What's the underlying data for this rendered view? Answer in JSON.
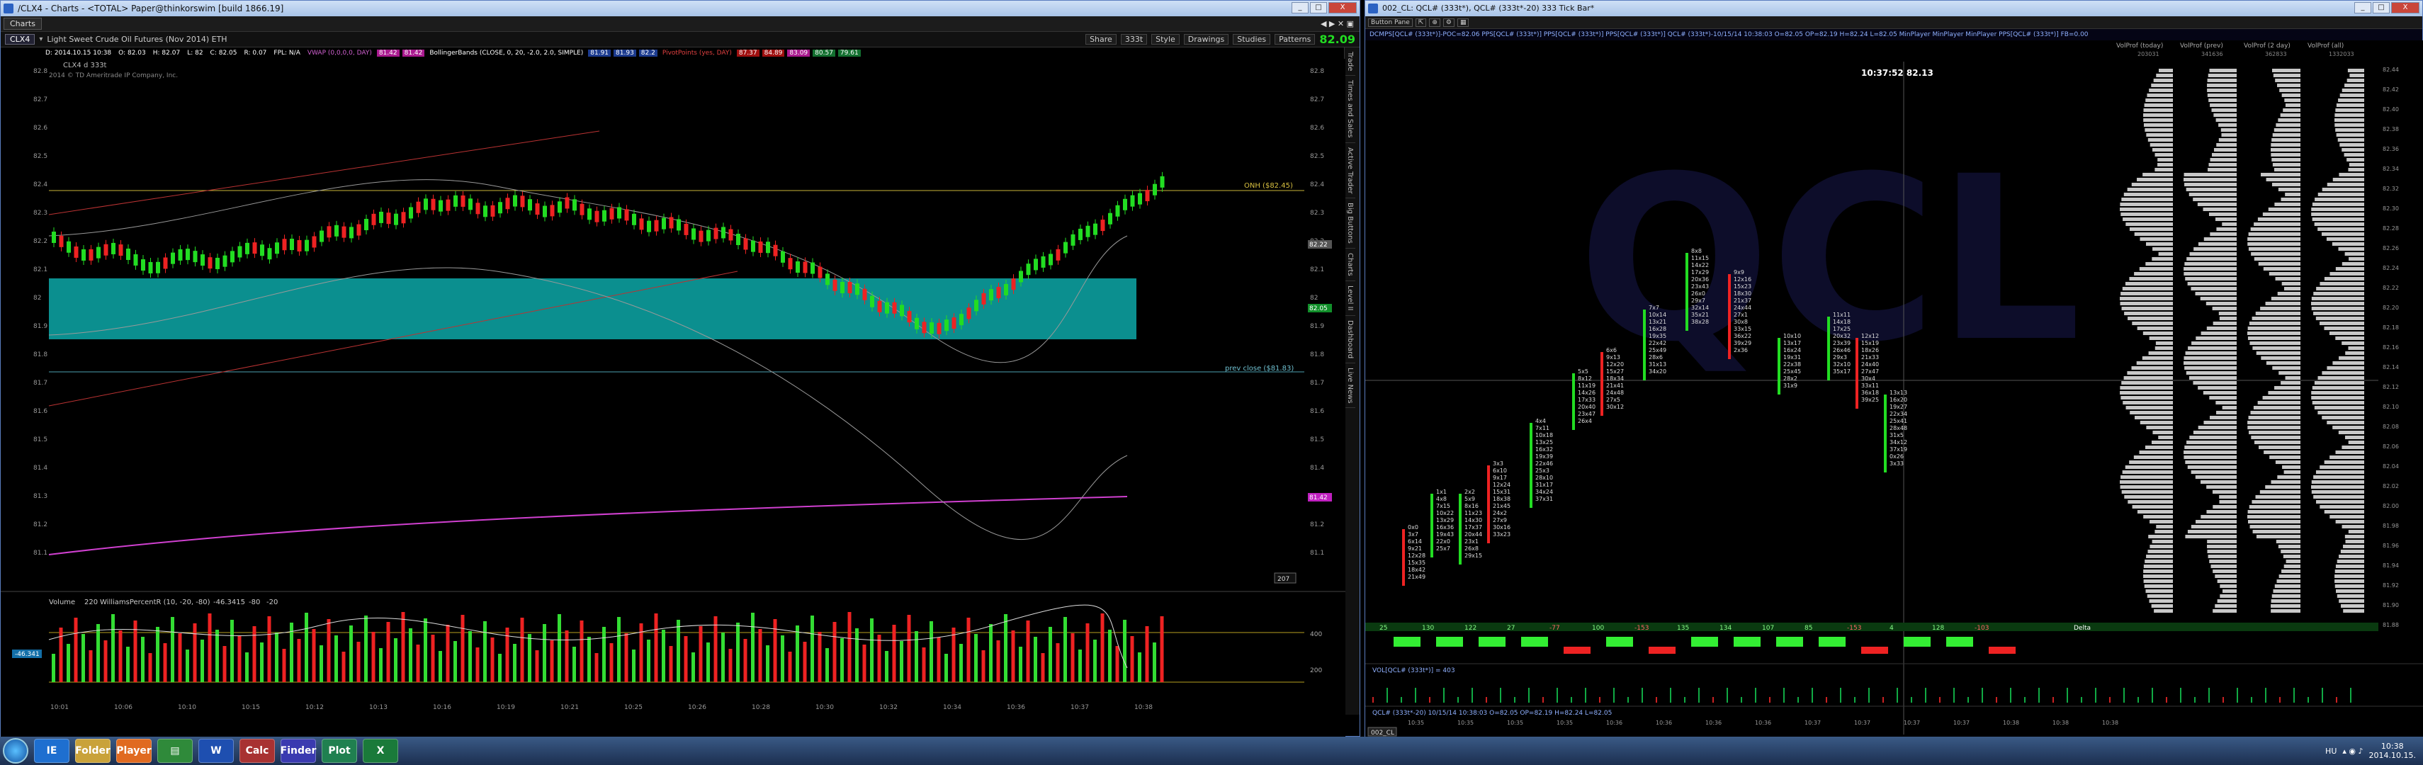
{
  "left": {
    "title": "/CLX4 - Charts - <TOTAL> Paper@thinkorswim [build 1866.19]",
    "tab": "Charts",
    "symbol": "CLX4",
    "description": "Light Sweet Crude Oil Futures (Nov 2014) ETH",
    "toolbar_buttons": [
      "Share",
      "Style",
      "Drawings",
      "Studies",
      "Patterns"
    ],
    "toolbar_sel": "333t",
    "last_price": "82.09",
    "status": {
      "d": "D: 2014.10.15 10:38",
      "o": "O: 82.03",
      "h": "H: 82.07",
      "l": "L: 82",
      "c": "C: 82.05",
      "r": "R: 0.07",
      "fpl": "FPL: N/A",
      "vwap": "VWAP (0,0,0,0, DAY)",
      "vwap1": "81.42",
      "vwap2": "81.42",
      "boll": "BollingerBands (CLOSE, 0, 20, -2.0, 2.0, SIMPLE)",
      "b1": "81.91",
      "b2": "81.93",
      "b3": "82.2",
      "pivots": "PivotPoints (yes, DAY)",
      "p1": "87.37",
      "p2": "84.89",
      "p3": "83.09",
      "p4": "80.57",
      "p5": "79.61"
    },
    "symbol_tag": "CLX4 d 333t",
    "copyright": "2014 © TD Ameritrade IP Company, Inc.",
    "onh_label": "ONH ($82.45)",
    "prevclose_label": "prev close ($81.83)",
    "price_ticks": [
      "82.8",
      "82.7",
      "82.6",
      "82.5",
      "82.4",
      "82.3",
      "82.2",
      "82.1",
      "82",
      "81.9",
      "81.8",
      "81.7",
      "81.6",
      "81.5",
      "81.4",
      "81.3",
      "81.2",
      "81.1"
    ],
    "right_tags": {
      "t1": "82.22",
      "t2": "82.05",
      "t3": "81.42",
      "t4": "207"
    },
    "time_ticks": [
      "10:01",
      "10:06",
      "10:10",
      "10:15",
      "10:12",
      "10:13",
      "10:16",
      "10:19",
      "10:21",
      "10:25",
      "10:26",
      "10:28",
      "10:30",
      "10:32",
      "10:34",
      "10:36",
      "10:37",
      "10:38"
    ],
    "volume_label": "Volume",
    "volume_val": "220",
    "wr_label": "WilliamsPercentR (10, -20, -80)",
    "wr_val": "-46.3415",
    "wr_v2": "-80",
    "wr_v3": "-20",
    "wr_tag": "-46.341",
    "lower_ticks": [
      "400",
      "200"
    ],
    "side_tabs": [
      "Trade",
      "Times and Sales",
      "Active Trader",
      "Big Buttons",
      "Charts",
      "Level II",
      "Dashboard",
      "Live News"
    ]
  },
  "right": {
    "title": "002_CL: QCL# (333t*), QCL# (333t*-20) 333 Tick Bar*",
    "button_pane": "Button Pane",
    "header": "DCMPS[QCL# (333t*)]-POC=82.06  PPS[QCL# (333t*)]  PPS[QCL# (333t*)]  PPS[QCL# (333t*)]  QCL# (333t*)-10/15/14 10:38:03 O=82.05 OP=82.19 H=82.24 L=82.05  MinPlayer  MinPlayer  MinPlayer  PPS[QCL# (333t*)] FB=0.00",
    "crosshair_label": "10:37:52  82.13",
    "crosshair_price": "82.13",
    "vp_headers": [
      "VolProf (today)",
      "VolProf (prev)",
      "VolProf (2 day)",
      "VolProf (all)"
    ],
    "vp_sub": [
      "203031",
      "341636",
      "362833",
      "1332033"
    ],
    "price_ticks": [
      "82.44",
      "82.42",
      "82.40",
      "82.38",
      "82.36",
      "82.34",
      "82.32",
      "82.30",
      "82.28",
      "82.26",
      "82.24",
      "82.22",
      "82.20",
      "82.18",
      "82.16",
      "82.14",
      "82.12",
      "82.10",
      "82.08",
      "82.06",
      "82.04",
      "82.02",
      "82.00",
      "81.98",
      "81.96",
      "81.94",
      "81.92",
      "81.90",
      "81.88"
    ],
    "delta_vals": [
      "25",
      "130",
      "122",
      "27",
      "-77",
      "100",
      "-153",
      "135",
      "134",
      "107",
      "85",
      "-153",
      "4",
      "128",
      "-103"
    ],
    "delta_label": "Delta",
    "vol_label": "VOL[QCL# (333t*)] = 403",
    "bottom_label": "QCL# (333t*-20) 10/15/14 10:38:03 O=82.05 OP=82.19 H=82.24 L=82.05",
    "time_ticks": [
      "10:35",
      "10:35",
      "10:35",
      "10:35",
      "10:36",
      "10:36",
      "10:36",
      "10:36",
      "10:37",
      "10:37",
      "10:37",
      "10:37",
      "10:38",
      "10:38",
      "10:38"
    ],
    "tab": "002_CL"
  },
  "taskbar": {
    "lang": "HU",
    "time": "10:38",
    "date": "2014.10.15.",
    "apps": [
      "IE",
      "Folder",
      "Player",
      "W",
      "Calc",
      "Finder",
      "Plot",
      "X"
    ]
  }
}
